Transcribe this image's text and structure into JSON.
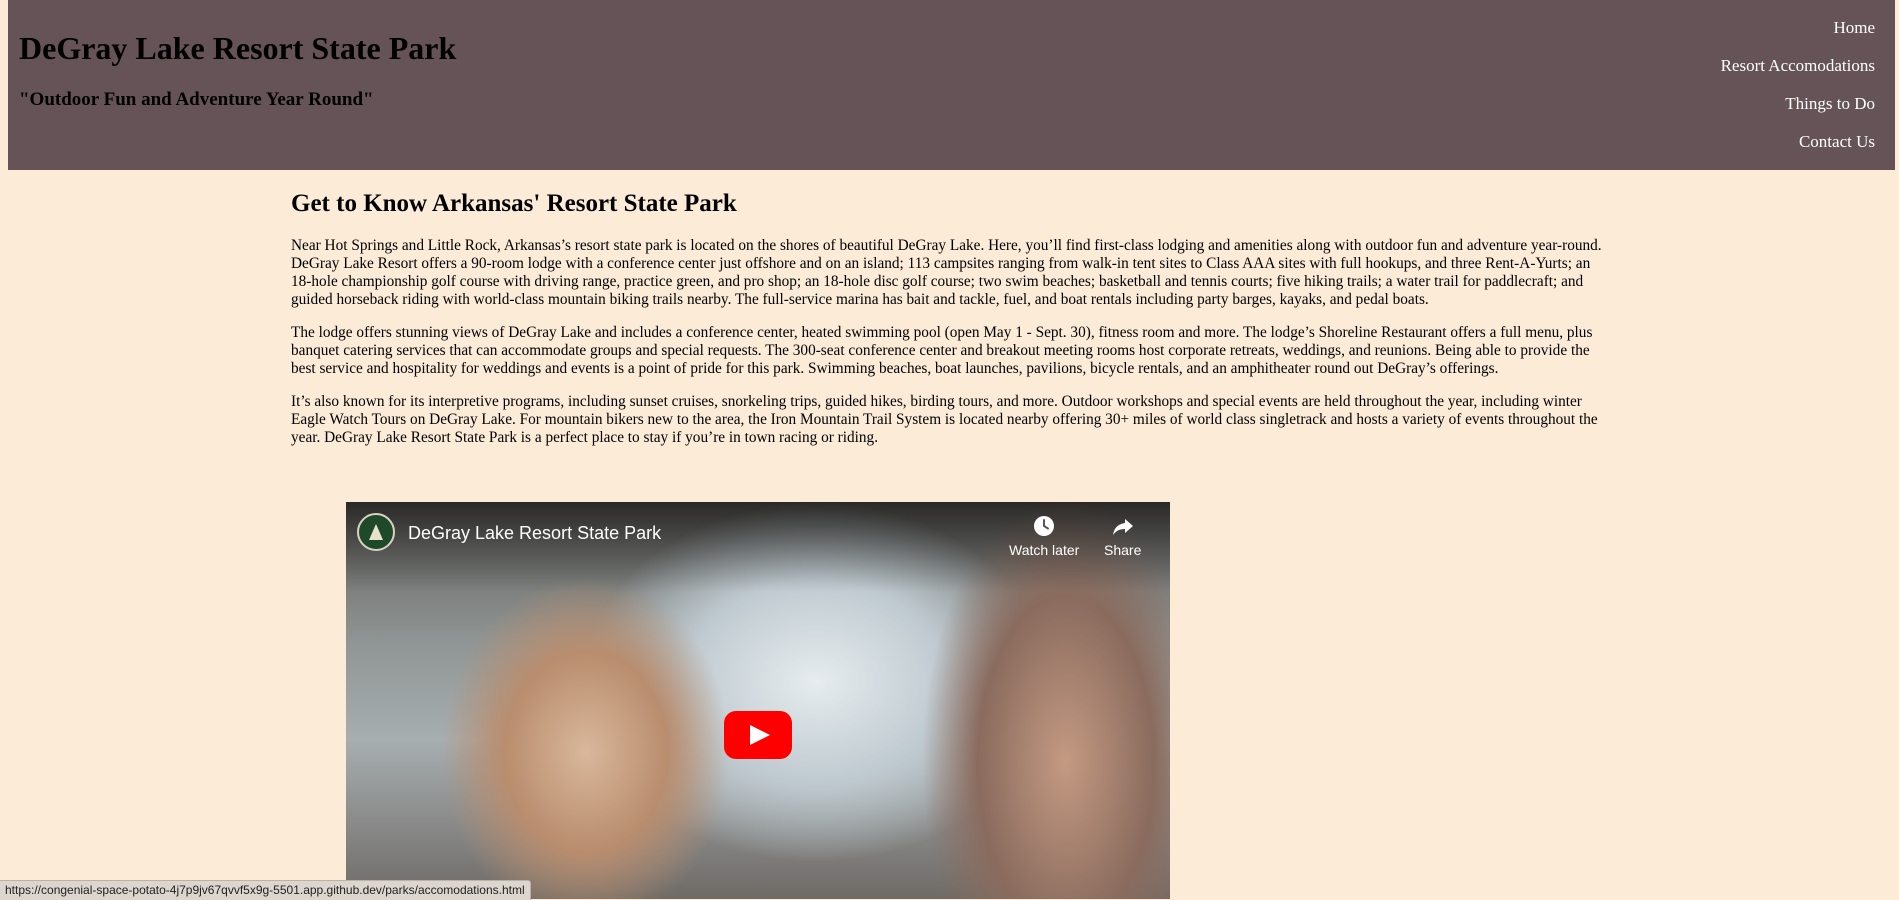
{
  "header": {
    "title": "DeGray Lake Resort State Park",
    "tagline": "\"Outdoor Fun and Adventure Year Round\"",
    "background_color": "#655357"
  },
  "nav": {
    "items": [
      {
        "label": "Home"
      },
      {
        "label": "Resort Accomodations"
      },
      {
        "label": "Things to Do"
      },
      {
        "label": "Contact Us"
      }
    ]
  },
  "main": {
    "heading": "Get to Know Arkansas' Resort State Park",
    "paragraphs": [
      "Near Hot Springs and Little Rock, Arkansas’s resort state park is located on the shores of beautiful DeGray Lake. Here, you’ll find first-class lodging and amenities along with outdoor fun and adventure year-round. DeGray Lake Resort offers a 90-room lodge with a conference center just offshore and on an island; 113 campsites ranging from walk-in tent sites to Class AAA sites with full hookups, and three Rent-A-Yurts; an 18-hole championship golf course with driving range, practice green, and pro shop; an 18-hole disc golf course; two swim beaches; basketball and tennis courts; five hiking trails; a water trail for paddlecraft; and guided horseback riding with world-class mountain biking trails nearby. The full-service marina has bait and tackle, fuel, and boat rentals including party barges, kayaks, and pedal boats.",
      "The lodge offers stunning views of DeGray Lake and includes a conference center, heated swimming pool (open May 1 - Sept. 30), fitness room and more. The lodge’s Shoreline Restaurant offers a full menu, plus banquet catering services that can accommodate groups and special requests. The 300-seat conference center and breakout meeting rooms host corporate retreats, weddings, and reunions. Being able to provide the best service and hospitality for weddings and events is a point of pride for this park. Swimming beaches, boat launches, pavilions, bicycle rentals, and an amphitheater round out DeGray’s offerings.",
      "It’s also known for its interpretive programs, including sunset cruises, snorkeling trips, guided hikes, birding tours, and more. Outdoor workshops and special events are held throughout the year, including winter Eagle Watch Tours on DeGray Lake. For mountain bikers new to the area, the Iron Mountain Trail System is located nearby offering 30+ miles of world class singletrack and hosts a variety of events throughout the year. DeGray Lake Resort State Park is a perfect place to stay if you’re in town racing or riding."
    ]
  },
  "video": {
    "title": "DeGray Lake Resort State Park",
    "watch_later_label": "Watch later",
    "share_label": "Share",
    "icons": {
      "watch_later": "clock-icon",
      "share": "share-arrow-icon",
      "play": "play-icon"
    },
    "play_color": "#ff0000"
  },
  "statusbar": {
    "url": "https://congenial-space-potato-4j7p9jv67qvvf5x9g-5501.app.github.dev/parks/accomodations.html"
  },
  "colors": {
    "page_background": "#fbebd7",
    "nav_text": "#ffffff"
  }
}
